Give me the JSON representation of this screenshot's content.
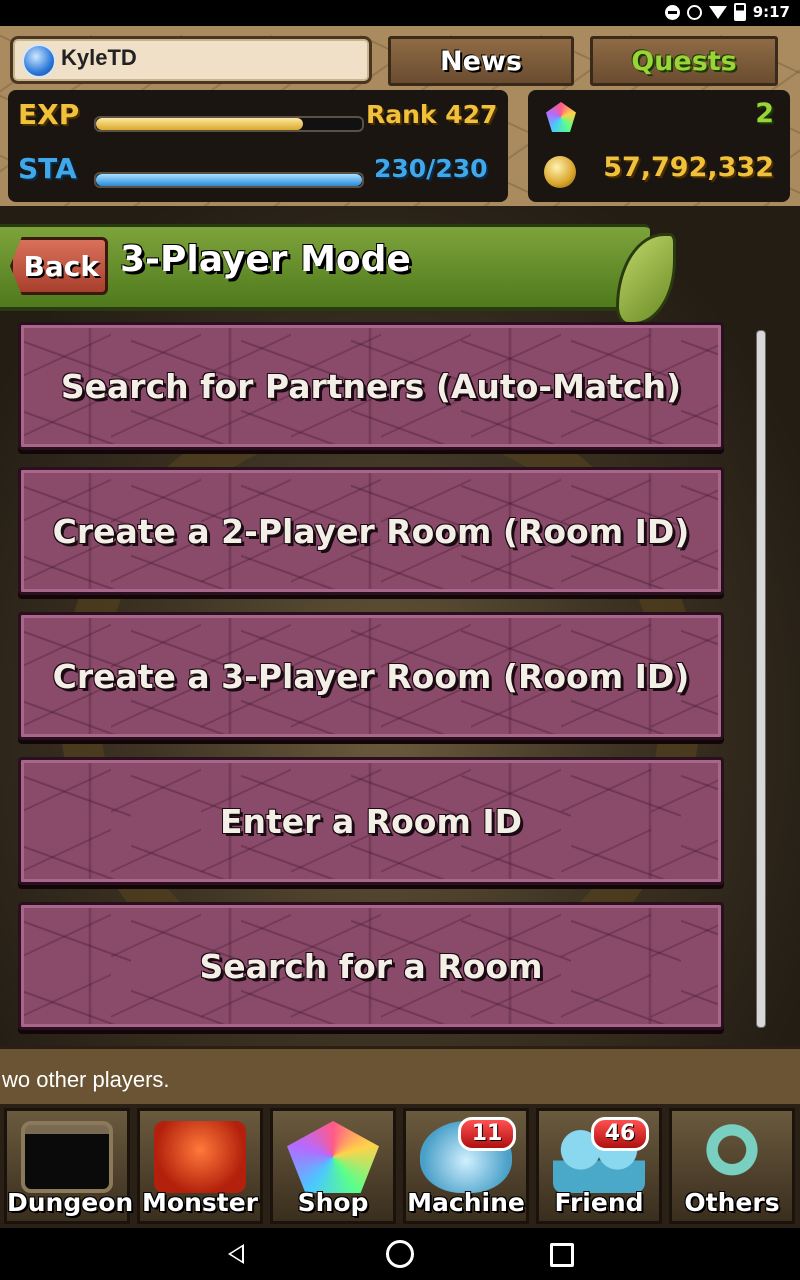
{
  "status_bar": {
    "time": "9:17",
    "icons": [
      "do-not-disturb-icon",
      "alarm-icon",
      "wifi-icon",
      "battery-icon"
    ]
  },
  "header": {
    "player_name": "KyleTD",
    "tabs": [
      {
        "label": "News"
      },
      {
        "label": "Quests"
      }
    ],
    "exp": {
      "label": "EXP",
      "rank_text": "Rank 427",
      "progress": 0.78
    },
    "sta": {
      "label": "STA",
      "value_text": "230/230",
      "progress": 1.0
    },
    "magic_stones": "2",
    "coins": "57,792,332"
  },
  "screen": {
    "back_label": "Back",
    "title": "3-Player Mode"
  },
  "menu": [
    {
      "label": "Search for Partners (Auto-Match)"
    },
    {
      "label": "Create a 2-Player Room (Room ID)"
    },
    {
      "label": "Create a 3-Player Room (Room ID)"
    },
    {
      "label": "Enter a Room ID"
    },
    {
      "label": "Search for a Room"
    }
  ],
  "description": "wo other players.",
  "bottom_nav": [
    {
      "label": "Dungeon"
    },
    {
      "label": "Monster"
    },
    {
      "label": "Shop"
    },
    {
      "label": "Machine",
      "badge": "11"
    },
    {
      "label": "Friend",
      "badge": "46"
    },
    {
      "label": "Others"
    }
  ],
  "colors": {
    "menu_button": "#8a4a6a",
    "title_bar": "#6a9a2e",
    "exp": "#f2c13b",
    "sta": "#40a8e8",
    "stones": "#9bd33b"
  }
}
